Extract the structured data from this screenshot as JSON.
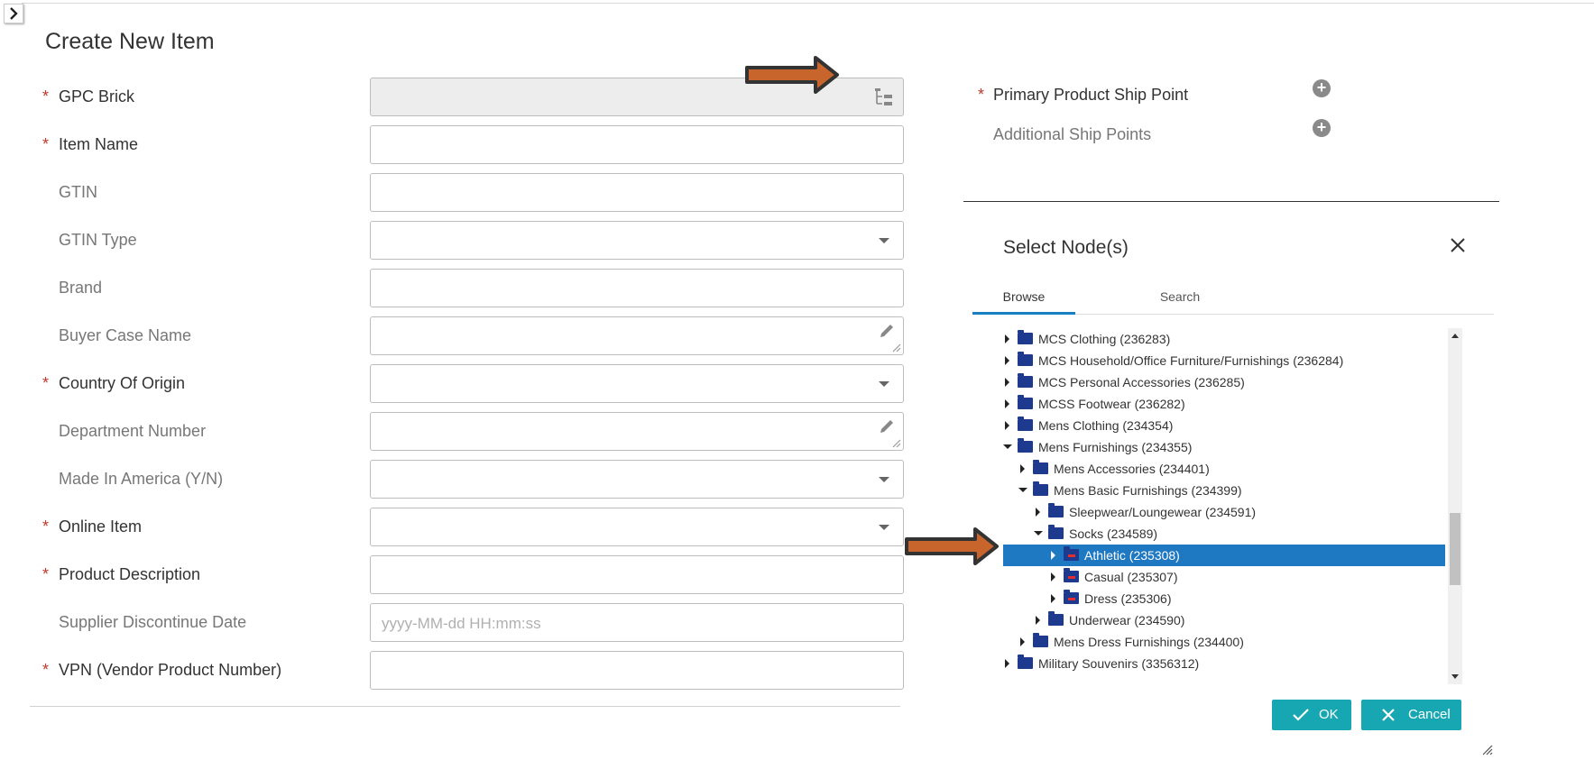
{
  "form": {
    "title": "Create New Item",
    "fields": [
      {
        "label": "GPC Brick",
        "required": true,
        "value": ""
      },
      {
        "label": "Item Name",
        "required": true,
        "value": ""
      },
      {
        "label": "GTIN",
        "required": false,
        "value": ""
      },
      {
        "label": "GTIN Type",
        "required": false,
        "value": ""
      },
      {
        "label": "Brand",
        "required": false,
        "value": ""
      },
      {
        "label": "Buyer Case Name",
        "required": false,
        "value": ""
      },
      {
        "label": "Country Of Origin",
        "required": true,
        "value": ""
      },
      {
        "label": "Department Number",
        "required": false,
        "value": ""
      },
      {
        "label": "Made In America (Y/N)",
        "required": false,
        "value": ""
      },
      {
        "label": "Online Item",
        "required": true,
        "value": ""
      },
      {
        "label": "Product Description",
        "required": true,
        "value": ""
      },
      {
        "label": "Supplier Discontinue Date",
        "required": false,
        "value": "",
        "placeholder": "yyyy-MM-dd HH:mm:ss"
      },
      {
        "label": "VPN (Vendor Product Number)",
        "required": true,
        "value": ""
      }
    ],
    "required_marker": "*"
  },
  "ship_points": {
    "primary_label": "Primary Product Ship Point",
    "additional_label": "Additional Ship Points",
    "add_symbol": "+"
  },
  "dialog": {
    "title": "Select Node(s)",
    "tabs": [
      "Browse",
      "Search"
    ],
    "active_tab": "Browse",
    "tree": [
      {
        "label": "MCS Clothing (236283)",
        "expanded": false,
        "selected": false
      },
      {
        "label": "MCS Household/Office Furniture/Furnishings (236284)",
        "expanded": false,
        "selected": false
      },
      {
        "label": "MCS Personal Accessories (236285)",
        "expanded": false,
        "selected": false
      },
      {
        "label": "MCSS Footwear (236282)",
        "expanded": false,
        "selected": false
      },
      {
        "label": "Mens Clothing (234354)",
        "expanded": false,
        "selected": false
      },
      {
        "label": "Mens Furnishings (234355)",
        "expanded": true,
        "selected": false
      },
      {
        "label": "Mens Accessories (234401)",
        "expanded": false,
        "selected": false
      },
      {
        "label": "Mens Basic Furnishings (234399)",
        "expanded": true,
        "selected": false
      },
      {
        "label": "Sleepwear/Loungewear (234591)",
        "expanded": false,
        "selected": false
      },
      {
        "label": "Socks (234589)",
        "expanded": true,
        "selected": false
      },
      {
        "label": "Athletic (235308)",
        "expanded": false,
        "selected": true,
        "leaf": true
      },
      {
        "label": "Casual (235307)",
        "expanded": false,
        "selected": false,
        "leaf": true
      },
      {
        "label": "Dress (235306)",
        "expanded": false,
        "selected": false,
        "leaf": true
      },
      {
        "label": "Underwear (234590)",
        "expanded": false,
        "selected": false
      },
      {
        "label": "Mens Dress Furnishings (234400)",
        "expanded": false,
        "selected": false
      },
      {
        "label": "Military Souvenirs (3356312)",
        "expanded": false,
        "selected": false
      }
    ],
    "ok_label": "OK",
    "cancel_label": "Cancel"
  },
  "colors": {
    "accent": "#17a7b3",
    "selection": "#1f78c2",
    "required": "#c0392b",
    "callout_arrow": "#c8652c",
    "folder": "#1e3a8f"
  }
}
